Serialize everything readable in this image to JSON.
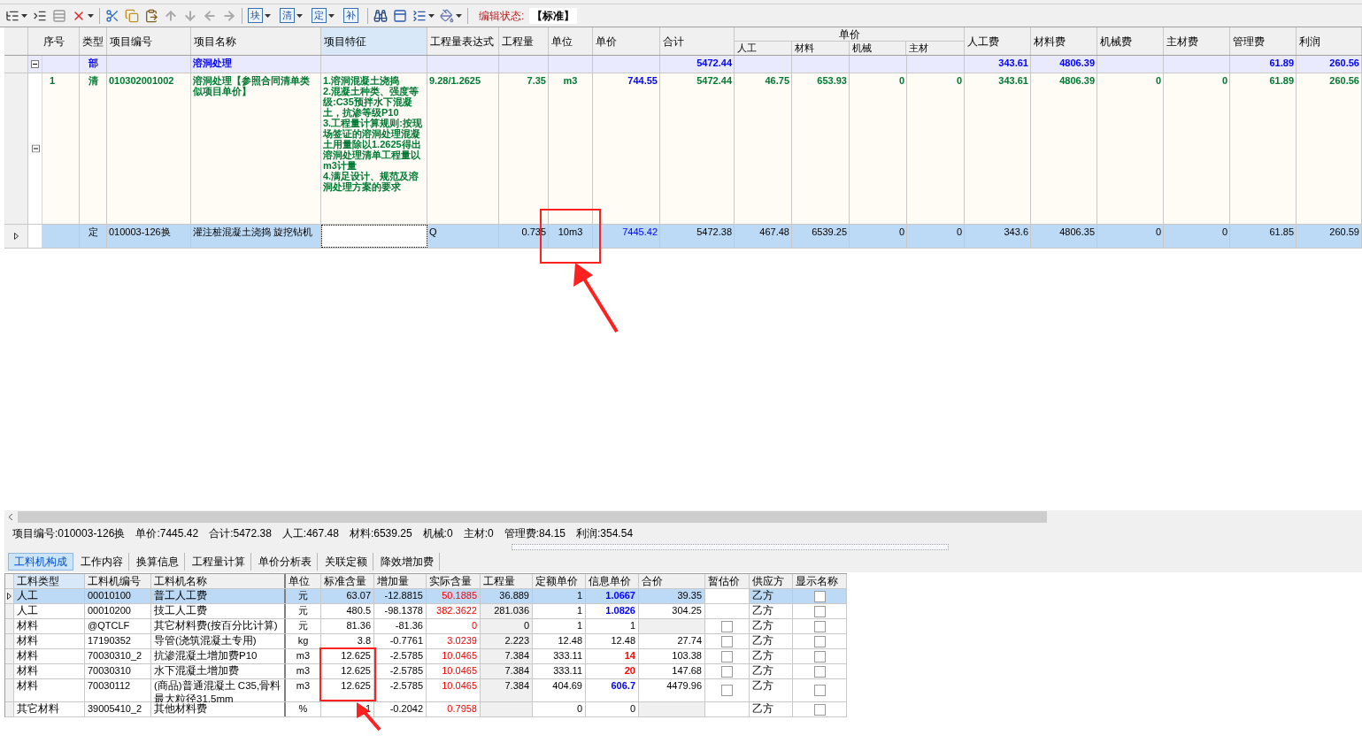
{
  "toolbar": {
    "glyph_buttons": [
      {
        "label": "块",
        "dropdown": true
      },
      {
        "label": "清",
        "dropdown": true
      },
      {
        "label": "定",
        "dropdown": true
      },
      {
        "label": "补",
        "dropdown": false
      }
    ],
    "edit_state_label": "编辑状态:",
    "edit_state": "【标准】"
  },
  "top_table": {
    "columns": [
      {
        "label": "序号"
      },
      {
        "label": "类型"
      },
      {
        "label": "项目编号"
      },
      {
        "label": "项目名称"
      },
      {
        "label": "项目特征",
        "highlighted": true
      },
      {
        "label": "工程量表达式"
      },
      {
        "label": "工程量"
      },
      {
        "label": "单位"
      },
      {
        "label": "单价"
      },
      {
        "label": "合计"
      },
      {
        "label": "人工"
      },
      {
        "label": "材料"
      },
      {
        "label": "机械"
      },
      {
        "label": "主材"
      },
      {
        "label": "人工费"
      },
      {
        "label": "材料费"
      },
      {
        "label": "机械费"
      },
      {
        "label": "主材费"
      },
      {
        "label": "管理费"
      },
      {
        "label": "利润"
      }
    ],
    "column_group": "单价",
    "rows": [
      {
        "kind": "section",
        "selected": false,
        "expanded": true,
        "cells": [
          null,
          "部",
          null,
          "溶洞处理",
          null,
          null,
          null,
          null,
          null,
          "5472.44",
          null,
          null,
          null,
          null,
          "343.61",
          "4806.39",
          null,
          null,
          "61.89",
          "260.56"
        ]
      },
      {
        "kind": "item",
        "selected": false,
        "expanded": true,
        "cells": [
          "1",
          "清",
          "010302001002",
          "溶洞处理【参照合同清单类似项目单价】",
          "1.溶洞混凝土浇捣\n2.混凝土种类、强度等级:C35预拌水下混凝土，抗渗等级P10\n3.工程量计算规则:按现场签证的溶洞处理混凝土用量除以1.2625得出溶洞处理清单工程量以m3计量\n4.满足设计、规范及溶洞处理方案的要求",
          "9.28/1.2625",
          "7.35",
          "m3",
          "744.55",
          "5472.44",
          "46.75",
          "653.93",
          "0",
          "0",
          "343.61",
          "4806.39",
          "0",
          "0",
          "61.89",
          "260.56"
        ]
      },
      {
        "kind": "quota",
        "selected": true,
        "cells": [
          null,
          "定",
          "010003-126换",
          "灌注桩混凝土浇捣 旋挖钻机",
          null,
          "Q",
          "0.735",
          "10m3",
          "7445.42",
          "5472.38",
          "467.48",
          "6539.25",
          "0",
          "0",
          "343.6",
          "4806.35",
          "0",
          "0",
          "61.85",
          "260.59"
        ]
      }
    ]
  },
  "info_bar": [
    "项目编号:010003-126换",
    "单价:7445.42",
    "合计:5472.38",
    "人工:467.48",
    "材料:6539.25",
    "机械:0",
    "主材:0",
    "管理费:84.15",
    "利润:354.54"
  ],
  "tabs": [
    {
      "label": "工料机构成",
      "selected": true
    },
    {
      "label": "工作内容",
      "selected": false
    },
    {
      "label": "换算信息",
      "selected": false
    },
    {
      "label": "工程量计算",
      "selected": false
    },
    {
      "label": "单价分析表",
      "selected": false
    },
    {
      "label": "关联定额",
      "selected": false
    },
    {
      "label": "降效增加费",
      "selected": false
    }
  ],
  "bottom_table": {
    "columns": [
      {
        "label": "工料类型",
        "highlighted": true
      },
      {
        "label": "工料机编号"
      },
      {
        "label": "工料机名称"
      },
      {
        "label": "单位"
      },
      {
        "label": "标准含量"
      },
      {
        "label": "增加量"
      },
      {
        "label": "实际含量"
      },
      {
        "label": "工程量"
      },
      {
        "label": "定额单价"
      },
      {
        "label": "信息单价"
      },
      {
        "label": "合价"
      },
      {
        "label": "暂估价"
      },
      {
        "label": "供应方"
      },
      {
        "label": "显示名称"
      }
    ],
    "rows": [
      {
        "selected": true,
        "type": "人工",
        "code": "00010100",
        "name": "普工人工费",
        "unit": "元",
        "std": "63.07",
        "added": "-12.8815",
        "actual": "50.1885",
        "qty": "36.889",
        "quota_price": "1",
        "info_price": "1.0667",
        "info_adjusted": true,
        "total": "39.35",
        "supplier": "乙方",
        "show_name": false
      },
      {
        "selected": false,
        "type": "人工",
        "code": "00010200",
        "name": "技工人工费",
        "unit": "元",
        "std": "480.5",
        "added": "-98.1378",
        "actual": "382.3622",
        "qty": "281.036",
        "quota_price": "1",
        "info_price": "1.0826",
        "info_adjusted": true,
        "total": "304.25",
        "supplier": "乙方",
        "show_name": false
      },
      {
        "selected": false,
        "type": "材料",
        "code": "@QTCLF",
        "name": "其它材料费(按百分比计算)",
        "unit": "元",
        "std": "81.36",
        "added": "-81.36",
        "actual": "0",
        "qty": "0",
        "quota_price": "1",
        "info_price": "1",
        "estimate": false,
        "supplier": "乙方",
        "show_name": false
      },
      {
        "selected": false,
        "type": "材料",
        "code": "17190352",
        "name": "导管(浇筑混凝土专用)",
        "unit": "kg",
        "std": "3.8",
        "added": "-0.7761",
        "actual": "3.0239",
        "qty": "2.223",
        "quota_price": "12.48",
        "info_price": "12.48",
        "total": "27.74",
        "estimate": false,
        "supplier": "乙方",
        "show_name": false
      },
      {
        "selected": false,
        "type": "材料",
        "code": "70030310_2",
        "name": "抗渗混凝土增加费P10",
        "unit": "m3",
        "std": "12.625",
        "added": "-2.5785",
        "actual": "10.0465",
        "qty": "7.384",
        "quota_price": "333.11",
        "info_price": "14",
        "info_warning": true,
        "total": "103.38",
        "estimate": false,
        "supplier": "乙方",
        "show_name": false
      },
      {
        "selected": false,
        "type": "材料",
        "code": "70030310",
        "name": "水下混凝土增加费",
        "unit": "m3",
        "std": "12.625",
        "added": "-2.5785",
        "actual": "10.0465",
        "qty": "7.384",
        "quota_price": "333.11",
        "info_price": "20",
        "info_warning": true,
        "total": "147.68",
        "estimate": false,
        "supplier": "乙方",
        "show_name": false
      },
      {
        "selected": false,
        "type": "材料",
        "code": "70030112",
        "name": "(商品)普通混凝土 C35,骨料最大粒径31.5mm",
        "unit": "m3",
        "std": "12.625",
        "added": "-2.5785",
        "actual": "10.0465",
        "qty": "7.384",
        "quota_price": "404.69",
        "info_price": "606.7",
        "info_adjusted": true,
        "total": "4479.96",
        "estimate": false,
        "supplier": "乙方",
        "show_name": false
      },
      {
        "selected": false,
        "type": "其它材料",
        "code": "39005410_2",
        "name": "其他材料费",
        "unit": "%",
        "std": "1",
        "added": "-0.2042",
        "actual": "0.7958",
        "quota_price": "0",
        "info_price": "0",
        "supplier": "乙方",
        "show_name": false
      }
    ]
  }
}
